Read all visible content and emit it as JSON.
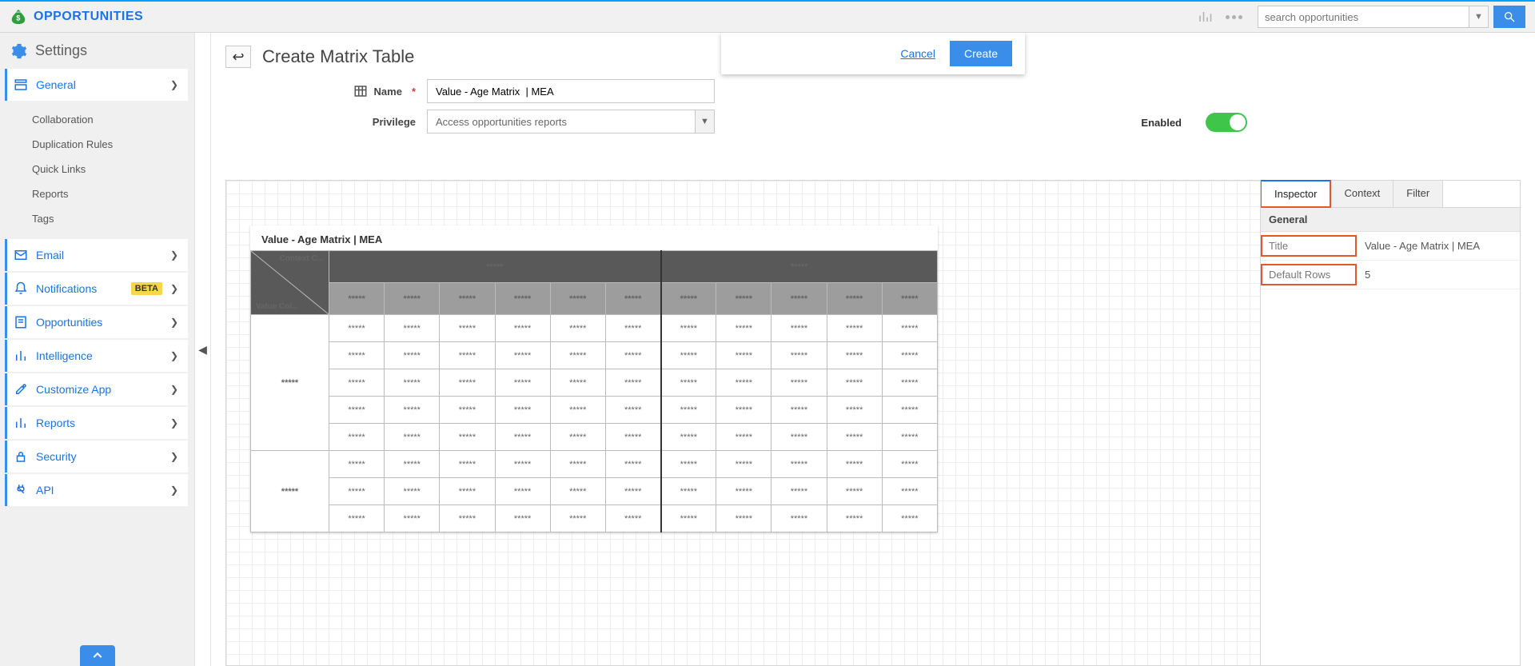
{
  "brand": "OPPORTUNITIES",
  "search": {
    "placeholder": "search opportunities"
  },
  "sidebar": {
    "heading": "Settings",
    "items": [
      {
        "label": "General",
        "icon": "layout",
        "expanded": true,
        "children": [
          "Collaboration",
          "Duplication Rules",
          "Quick Links",
          "Reports",
          "Tags"
        ]
      },
      {
        "label": "Email",
        "icon": "envelope"
      },
      {
        "label": "Notifications",
        "icon": "bell",
        "badge": "BETA"
      },
      {
        "label": "Opportunities",
        "icon": "form"
      },
      {
        "label": "Intelligence",
        "icon": "bars"
      },
      {
        "label": "Customize App",
        "icon": "tools"
      },
      {
        "label": "Reports",
        "icon": "bars"
      },
      {
        "label": "Security",
        "icon": "lock"
      },
      {
        "label": "API",
        "icon": "plug"
      }
    ]
  },
  "actions": {
    "cancel": "Cancel",
    "create": "Create"
  },
  "page": {
    "title": "Create Matrix Table"
  },
  "form": {
    "name_label": "Name",
    "name_value": "Value - Age Matrix  | MEA",
    "privilege_label": "Privilege",
    "privilege_value": "Access opportunities reports",
    "enabled_label": "Enabled",
    "enabled": true
  },
  "matrix": {
    "title": "Value - Age Matrix | MEA",
    "corner_top": "Context C...",
    "corner_bottom": "Value Col...",
    "group1": "*****",
    "group2": "*****",
    "cols": [
      "*****",
      "*****",
      "*****",
      "*****",
      "*****",
      "*****",
      "*****",
      "*****",
      "*****",
      "*****",
      "*****"
    ],
    "rowgroups": [
      {
        "label": "*****",
        "rows": 5
      },
      {
        "label": "*****",
        "rows": 3
      }
    ],
    "cell": "*****"
  },
  "inspector": {
    "tabs": [
      "Inspector",
      "Context",
      "Filter"
    ],
    "active_tab": 0,
    "section": "General",
    "props": [
      {
        "key": "Title",
        "value": "Value - Age Matrix | MEA",
        "highlight": true
      },
      {
        "key": "Default Rows",
        "value": "5",
        "highlight": true
      }
    ]
  }
}
